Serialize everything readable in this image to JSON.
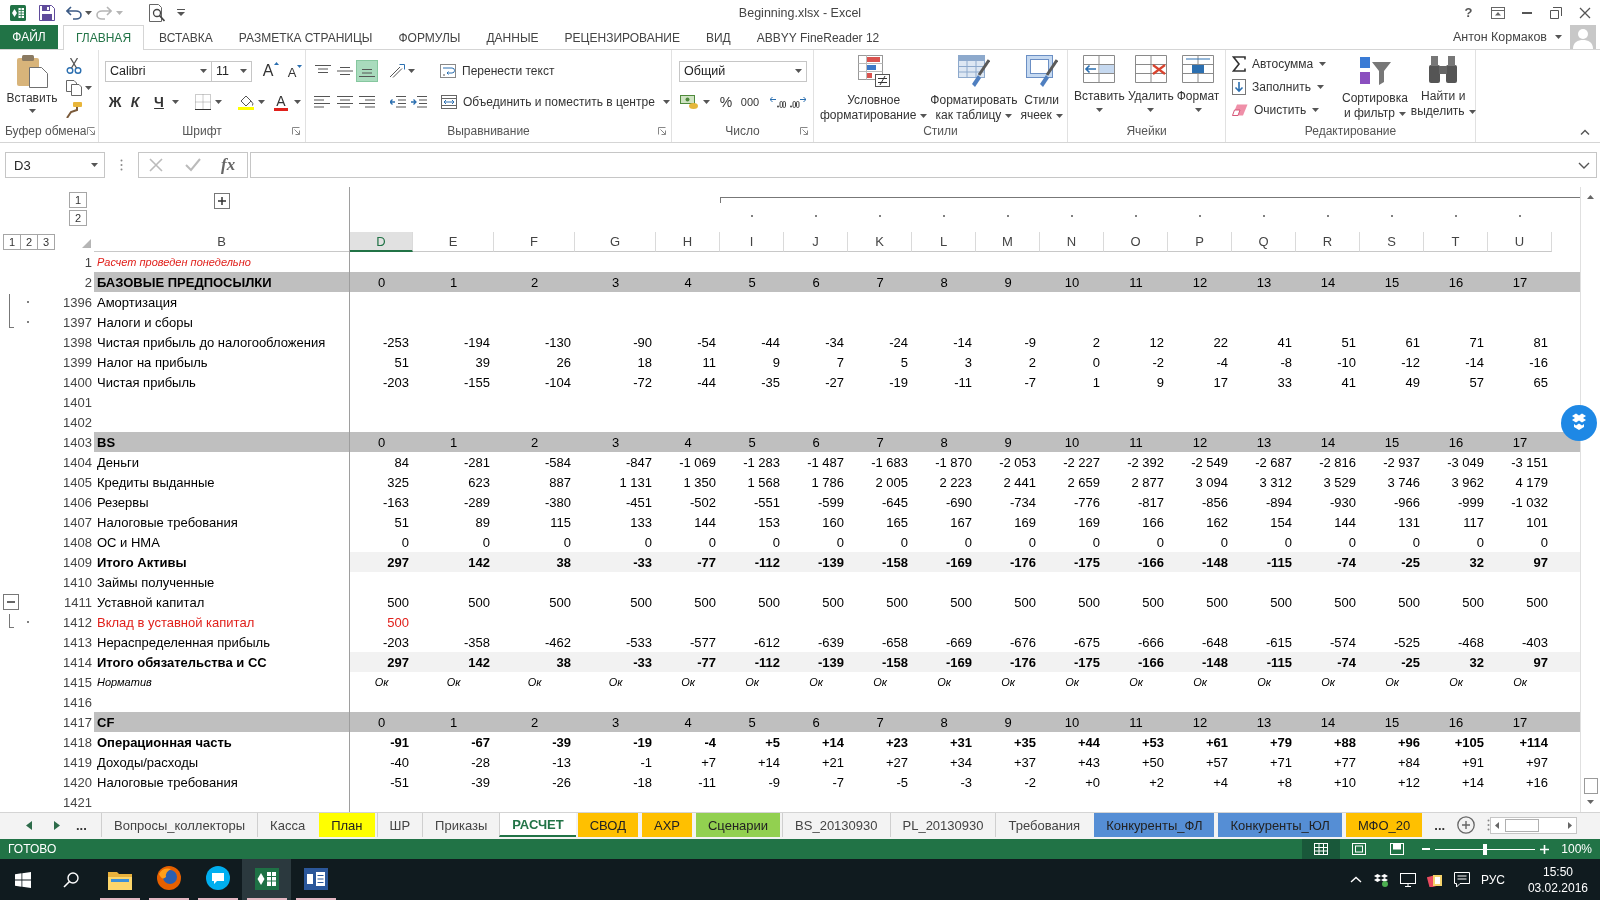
{
  "title_bar": {
    "title": "Beginning.xlsx - Excel",
    "help": "?"
  },
  "ribbon": {
    "tabs": [
      {
        "label": "ФАЙЛ",
        "kind": "file",
        "selected": false
      },
      {
        "label": "ГЛАВНАЯ",
        "kind": "tab",
        "selected": true
      },
      {
        "label": "ВСТАВКА",
        "kind": "tab",
        "selected": false
      },
      {
        "label": "РАЗМЕТКА СТРАНИЦЫ",
        "kind": "tab",
        "selected": false
      },
      {
        "label": "ФОРМУЛЫ",
        "kind": "tab",
        "selected": false
      },
      {
        "label": "ДАННЫЕ",
        "kind": "tab",
        "selected": false
      },
      {
        "label": "РЕЦЕНЗИРОВАНИЕ",
        "kind": "tab",
        "selected": false
      },
      {
        "label": "ВИД",
        "kind": "tab",
        "selected": false
      },
      {
        "label": "ABBYY FineReader 12",
        "kind": "tab",
        "selected": false
      }
    ],
    "user": "Антон Кормаков",
    "clipboard": {
      "label": "Буфер обмена",
      "paste": "Вставить"
    },
    "font": {
      "label": "Шрифт",
      "name": "Calibri",
      "size": "11",
      "grow": "A",
      "shrink": "A",
      "styles": [
        {
          "label": "Ж",
          "kind": "bold"
        },
        {
          "label": "К",
          "kind": "italic"
        },
        {
          "label": "Ч",
          "kind": "underline"
        }
      ],
      "font_color": "A"
    },
    "alignment": {
      "label": "Выравнивание",
      "vertical": [
        {
          "kind": "top",
          "selected": false
        },
        {
          "kind": "middle",
          "selected": false
        },
        {
          "kind": "bottom",
          "selected": true
        }
      ],
      "wrap": "Перенести текст",
      "merge": "Объединить и поместить в центре"
    },
    "number": {
      "label": "Число",
      "format": "Общий",
      "percent": "%",
      "thousands": "000"
    },
    "styles": {
      "label": "Стили",
      "buttons": [
        {
          "kind": "conditional",
          "label": "Условное\nформатирование"
        },
        {
          "kind": "table",
          "label": "Форматировать\nкак таблицу"
        },
        {
          "kind": "cell",
          "label": "Стили\nячеек"
        }
      ]
    },
    "cells": {
      "label": "Ячейки",
      "buttons": [
        {
          "kind": "insert",
          "label": "Вставить"
        },
        {
          "kind": "delete",
          "label": "Удалить"
        },
        {
          "kind": "format",
          "label": "Формат"
        }
      ]
    },
    "editing": {
      "label": "Редактирование",
      "commands": [
        {
          "kind": "autosum",
          "label": "Автосумма"
        },
        {
          "kind": "fill",
          "label": "Заполнить"
        },
        {
          "kind": "clear",
          "label": "Очистить"
        }
      ],
      "buttons": [
        {
          "kind": "sort",
          "label": "Сортировка\nи фильтр"
        },
        {
          "kind": "find",
          "label": "Найти и\nвыделить"
        }
      ]
    }
  },
  "formula_bar": {
    "name_box": "D3",
    "function": "fx"
  },
  "outline": {
    "row_levels": [
      "1",
      "2",
      "3"
    ],
    "column_levels": [
      "1",
      "2"
    ]
  },
  "columns": [
    {
      "label": "B",
      "selected": false,
      "expand_button": true,
      "grouped": false
    },
    {
      "label": "D",
      "selected": true,
      "expand_button": false,
      "grouped": false
    },
    {
      "label": "E",
      "selected": false,
      "expand_button": false,
      "grouped": false
    },
    {
      "label": "F",
      "selected": false,
      "expand_button": false,
      "grouped": false
    },
    {
      "label": "G",
      "selected": false,
      "expand_button": false,
      "grouped": false
    },
    {
      "label": "H",
      "selected": false,
      "expand_button": false,
      "grouped": false
    },
    {
      "label": "I",
      "selected": false,
      "expand_button": false,
      "grouped": true
    },
    {
      "label": "J",
      "selected": false,
      "expand_button": false,
      "grouped": true
    },
    {
      "label": "K",
      "selected": false,
      "expand_button": false,
      "grouped": true
    },
    {
      "label": "L",
      "selected": false,
      "expand_button": false,
      "grouped": true
    },
    {
      "label": "M",
      "selected": false,
      "expand_button": false,
      "grouped": true
    },
    {
      "label": "N",
      "selected": false,
      "expand_button": false,
      "grouped": true
    },
    {
      "label": "O",
      "selected": false,
      "expand_button": false,
      "grouped": true
    },
    {
      "label": "P",
      "selected": false,
      "expand_button": false,
      "grouped": true
    },
    {
      "label": "Q",
      "selected": false,
      "expand_button": false,
      "grouped": true
    },
    {
      "label": "R",
      "selected": false,
      "expand_button": false,
      "grouped": true
    },
    {
      "label": "S",
      "selected": false,
      "expand_button": false,
      "grouped": true
    },
    {
      "label": "T",
      "selected": false,
      "expand_button": false,
      "grouped": true
    },
    {
      "label": "U",
      "selected": false,
      "expand_button": false,
      "grouped": true
    }
  ],
  "rows": [
    {
      "number": "1",
      "kind": "note",
      "grouped": false,
      "collapse_button": false,
      "label": "Расчет проведен понедельно"
    },
    {
      "number": "2",
      "kind": "section",
      "grouped": false,
      "collapse_button": false,
      "label": "БАЗОВЫЕ ПРЕДПОСЫЛКИ",
      "values": [
        "0",
        "1",
        "2",
        "3",
        "4",
        "5",
        "6",
        "7",
        "8",
        "9",
        "10",
        "11",
        "12",
        "13",
        "14",
        "15",
        "16",
        "17"
      ]
    },
    {
      "number": "1396",
      "kind": "item",
      "grouped": true,
      "collapse_button": false,
      "label": "Амортизация"
    },
    {
      "number": "1397",
      "kind": "item",
      "grouped": true,
      "collapse_button": false,
      "label": "Налоги и сборы"
    },
    {
      "number": "1398",
      "kind": "item",
      "grouped": false,
      "collapse_button": false,
      "label": "Чистая прибыль до налогообложения",
      "values": [
        "-253",
        "-194",
        "-130",
        "-90",
        "-54",
        "-44",
        "-34",
        "-24",
        "-14",
        "-9",
        "2",
        "12",
        "22",
        "41",
        "51",
        "61",
        "71",
        "81"
      ]
    },
    {
      "number": "1399",
      "kind": "item",
      "grouped": false,
      "collapse_button": false,
      "label": "Налог на прибыль",
      "values": [
        "51",
        "39",
        "26",
        "18",
        "11",
        "9",
        "7",
        "5",
        "3",
        "2",
        "0",
        "-2",
        "-4",
        "-8",
        "-10",
        "-12",
        "-14",
        "-16"
      ]
    },
    {
      "number": "1400",
      "kind": "item",
      "grouped": false,
      "collapse_button": false,
      "label": "Чистая прибыль",
      "values": [
        "-203",
        "-155",
        "-104",
        "-72",
        "-44",
        "-35",
        "-27",
        "-19",
        "-11",
        "-7",
        "1",
        "9",
        "17",
        "33",
        "41",
        "49",
        "57",
        "65"
      ]
    },
    {
      "number": "1401",
      "kind": "item",
      "grouped": false,
      "collapse_button": false
    },
    {
      "number": "1402",
      "kind": "item",
      "grouped": false,
      "collapse_button": false
    },
    {
      "number": "1403",
      "kind": "section",
      "grouped": false,
      "collapse_button": false,
      "label": "BS",
      "values": [
        "0",
        "1",
        "2",
        "3",
        "4",
        "5",
        "6",
        "7",
        "8",
        "9",
        "10",
        "11",
        "12",
        "13",
        "14",
        "15",
        "16",
        "17"
      ]
    },
    {
      "number": "1404",
      "kind": "item",
      "grouped": false,
      "collapse_button": false,
      "label": "Деньги",
      "values": [
        "84",
        "-281",
        "-584",
        "-847",
        "-1 069",
        "-1 283",
        "-1 487",
        "-1 683",
        "-1 870",
        "-2 053",
        "-2 227",
        "-2 392",
        "-2 549",
        "-2 687",
        "-2 816",
        "-2 937",
        "-3 049",
        "-3 151"
      ]
    },
    {
      "number": "1405",
      "kind": "item",
      "grouped": false,
      "collapse_button": false,
      "label": "Кредиты выданные",
      "values": [
        "325",
        "623",
        "887",
        "1 131",
        "1 350",
        "1 568",
        "1 786",
        "2 005",
        "2 223",
        "2 441",
        "2 659",
        "2 877",
        "3 094",
        "3 312",
        "3 529",
        "3 746",
        "3 962",
        "4 179"
      ]
    },
    {
      "number": "1406",
      "kind": "item",
      "grouped": false,
      "collapse_button": false,
      "label": "Резервы",
      "values": [
        "-163",
        "-289",
        "-380",
        "-451",
        "-502",
        "-551",
        "-599",
        "-645",
        "-690",
        "-734",
        "-776",
        "-817",
        "-856",
        "-894",
        "-930",
        "-966",
        "-999",
        "-1 032"
      ]
    },
    {
      "number": "1407",
      "kind": "item",
      "grouped": false,
      "collapse_button": false,
      "label": "Налоговые требования",
      "values": [
        "51",
        "89",
        "115",
        "133",
        "144",
        "153",
        "160",
        "165",
        "167",
        "169",
        "169",
        "166",
        "162",
        "154",
        "144",
        "131",
        "117",
        "101"
      ]
    },
    {
      "number": "1408",
      "kind": "item",
      "grouped": false,
      "collapse_button": false,
      "label": "ОС и НМА",
      "values": [
        "0",
        "0",
        "0",
        "0",
        "0",
        "0",
        "0",
        "0",
        "0",
        "0",
        "0",
        "0",
        "0",
        "0",
        "0",
        "0",
        "0",
        "0"
      ]
    },
    {
      "number": "1409",
      "kind": "total",
      "grouped": false,
      "collapse_button": false,
      "label": "Итого Активы",
      "values": [
        "297",
        "142",
        "38",
        "-33",
        "-77",
        "-112",
        "-139",
        "-158",
        "-169",
        "-176",
        "-175",
        "-166",
        "-148",
        "-115",
        "-74",
        "-25",
        "32",
        "97"
      ]
    },
    {
      "number": "1410",
      "kind": "item",
      "grouped": false,
      "collapse_button": false,
      "label": "Займы полученные"
    },
    {
      "number": "1411",
      "kind": "item",
      "grouped": false,
      "collapse_button": true,
      "label": "Уставной капитал",
      "values": [
        "500",
        "500",
        "500",
        "500",
        "500",
        "500",
        "500",
        "500",
        "500",
        "500",
        "500",
        "500",
        "500",
        "500",
        "500",
        "500",
        "500",
        "500"
      ]
    },
    {
      "number": "1412",
      "kind": "warning",
      "grouped": true,
      "collapse_button": false,
      "label": "Вклад в уставной капитал",
      "values": [
        "500"
      ]
    },
    {
      "number": "1413",
      "kind": "item",
      "grouped": false,
      "collapse_button": false,
      "label": "Нераспределенная прибыль",
      "values": [
        "-203",
        "-358",
        "-462",
        "-533",
        "-577",
        "-612",
        "-639",
        "-658",
        "-669",
        "-676",
        "-675",
        "-666",
        "-648",
        "-615",
        "-574",
        "-525",
        "-468",
        "-403"
      ]
    },
    {
      "number": "1414",
      "kind": "total",
      "grouped": false,
      "collapse_button": false,
      "label": "Итого обязательства и СС",
      "values": [
        "297",
        "142",
        "38",
        "-33",
        "-77",
        "-112",
        "-139",
        "-158",
        "-169",
        "-176",
        "-175",
        "-166",
        "-148",
        "-115",
        "-74",
        "-25",
        "32",
        "97"
      ]
    },
    {
      "number": "1415",
      "kind": "check",
      "grouped": false,
      "collapse_button": false,
      "label": "Норматив",
      "values": [
        "Ок",
        "Ок",
        "Ок",
        "Ок",
        "Ок",
        "Ок",
        "Ок",
        "Ок",
        "Ок",
        "Ок",
        "Ок",
        "Ок",
        "Ок",
        "Ок",
        "Ок",
        "Ок",
        "Ок",
        "Ок"
      ]
    },
    {
      "number": "1416",
      "kind": "item",
      "grouped": false,
      "collapse_button": false
    },
    {
      "number": "1417",
      "kind": "section",
      "grouped": false,
      "collapse_button": false,
      "label": "CF",
      "values": [
        "0",
        "1",
        "2",
        "3",
        "4",
        "5",
        "6",
        "7",
        "8",
        "9",
        "10",
        "11",
        "12",
        "13",
        "14",
        "15",
        "16",
        "17"
      ]
    },
    {
      "number": "1418",
      "kind": "bold",
      "grouped": false,
      "collapse_button": false,
      "label": "Операционная часть",
      "values": [
        "-91",
        "-67",
        "-39",
        "-19",
        "-4",
        "+5",
        "+14",
        "+23",
        "+31",
        "+35",
        "+44",
        "+53",
        "+61",
        "+79",
        "+88",
        "+96",
        "+105",
        "+114"
      ]
    },
    {
      "number": "1419",
      "kind": "item",
      "grouped": false,
      "collapse_button": false,
      "label": "Доходы/расходы",
      "values": [
        "-40",
        "-28",
        "-13",
        "-1",
        "+7",
        "+14",
        "+21",
        "+27",
        "+34",
        "+37",
        "+43",
        "+50",
        "+57",
        "+71",
        "+77",
        "+84",
        "+91",
        "+97"
      ]
    },
    {
      "number": "1420",
      "kind": "item",
      "grouped": false,
      "collapse_button": false,
      "label": "Налоговые требования",
      "values": [
        "-51",
        "-39",
        "-26",
        "-18",
        "-11",
        "-9",
        "-7",
        "-5",
        "-3",
        "-2",
        "+0",
        "+2",
        "+4",
        "+8",
        "+10",
        "+12",
        "+14",
        "+16"
      ]
    },
    {
      "number": "1421",
      "kind": "item",
      "grouped": false,
      "collapse_button": false
    }
  ],
  "sheet_bar": {
    "more_before": "...",
    "more_after": "..."
  },
  "sheet_tabs": [
    {
      "label": "Вопросы_коллекторы",
      "selected": false
    },
    {
      "label": "Касса",
      "selected": false
    },
    {
      "label": "План",
      "selected": false,
      "color": "#ffff00"
    },
    {
      "label": "ШР",
      "selected": false
    },
    {
      "label": "Приказы",
      "selected": false
    },
    {
      "label": "РАСЧЕТ",
      "selected": true
    },
    {
      "label": "СВОД",
      "selected": false,
      "color": "#ffc000"
    },
    {
      "label": "АХР",
      "selected": false,
      "color": "#ffc000"
    },
    {
      "label": "Сценарии",
      "selected": false,
      "color": "#92d050"
    },
    {
      "label": "BS_20130930",
      "selected": false
    },
    {
      "label": "PL_20130930",
      "selected": false
    },
    {
      "label": "Требования",
      "selected": false
    },
    {
      "label": "Конкуренты_ФЛ",
      "selected": false,
      "color": "#558ed5"
    },
    {
      "label": "Конкуренты_ЮЛ",
      "selected": false,
      "color": "#558ed5"
    },
    {
      "label": "МФО_20",
      "selected": false,
      "color": "#ffc000"
    }
  ],
  "status_bar": {
    "status": "ГОТОВО",
    "views": [
      {
        "kind": "normal",
        "selected": true
      },
      {
        "kind": "page_layout",
        "selected": false
      },
      {
        "kind": "page_break",
        "selected": false
      }
    ],
    "zoom": {
      "level": 0.5,
      "reading": "100%"
    }
  },
  "taskbar": {
    "apps": [
      {
        "kind": "explorer",
        "running": true,
        "selected": false
      },
      {
        "kind": "browser",
        "running": true,
        "selected": false
      },
      {
        "kind": "messenger",
        "running": true,
        "selected": false
      },
      {
        "kind": "spreadsheet",
        "running": true,
        "selected": true
      },
      {
        "kind": "document",
        "running": true,
        "selected": false
      }
    ],
    "language": "РУС",
    "time": "15:50",
    "date": "03.02.2016"
  }
}
